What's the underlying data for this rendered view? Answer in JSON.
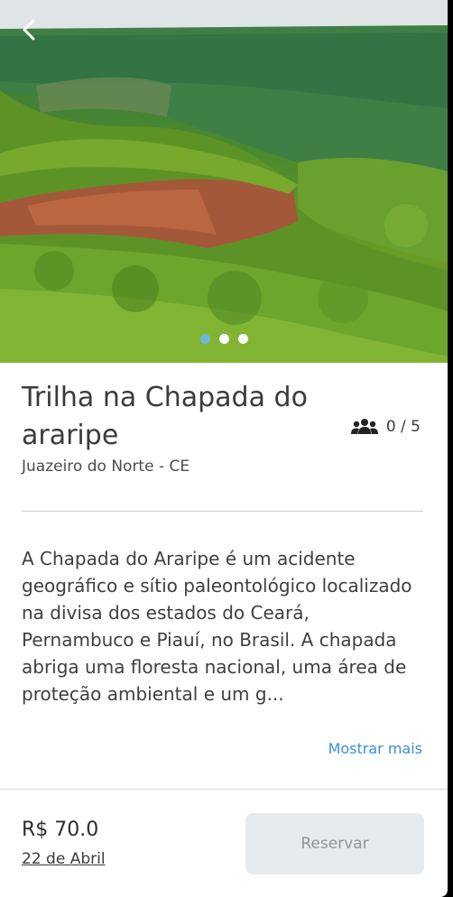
{
  "hero": {
    "image_alt": "Chapada do Araripe",
    "carousel": {
      "count": 3,
      "active_index": 0
    }
  },
  "event": {
    "title": "Trilha na Chapada do araripe",
    "location": "Juazeiro do Norte - CE",
    "capacity": "0 / 5",
    "description": "A Chapada do Araripe é um acidente geográfico e sítio paleontológico localizado na divisa dos estados do Ceará, Pernambuco e Piauí, no Brasil. A chapada abriga uma floresta nacional, uma área de proteção ambiental e um g...",
    "more_label": "Mostrar mais"
  },
  "footer": {
    "price": "R$ 70.0",
    "date": "22 de Abril",
    "reserve_label": "Reservar"
  },
  "icons": {
    "back": "chevron-left-icon",
    "capacity": "group-icon"
  },
  "colors": {
    "accent": "#3a8edb",
    "active_dot": "#6fb7d9",
    "button_disabled_bg": "#e8ebee"
  }
}
